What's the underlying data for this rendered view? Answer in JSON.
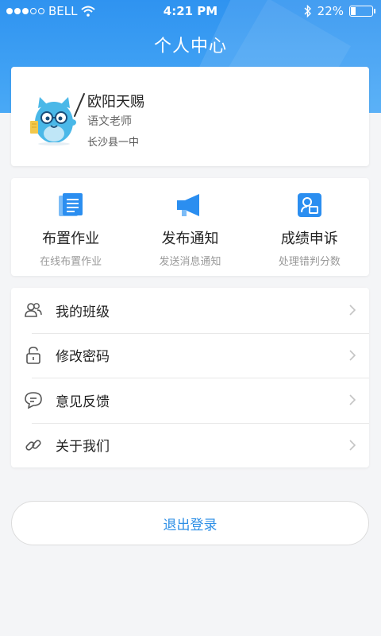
{
  "status_bar": {
    "carrier": "BELL",
    "time": "4:21 PM",
    "battery": "22%",
    "battery_level": 0.22
  },
  "header": {
    "title": "个人中心"
  },
  "profile": {
    "name": "欧阳天赐",
    "role": "语文老师",
    "school": "长沙县一中"
  },
  "actions": [
    {
      "title": "布置作业",
      "subtitle": "在线布置作业",
      "icon": "document-icon"
    },
    {
      "title": "发布通知",
      "subtitle": "发送消息通知",
      "icon": "megaphone-icon"
    },
    {
      "title": "成绩申诉",
      "subtitle": "处理错判分数",
      "icon": "appeal-icon"
    }
  ],
  "menu": [
    {
      "label": "我的班级",
      "icon": "group-icon"
    },
    {
      "label": "修改密码",
      "icon": "lock-icon"
    },
    {
      "label": "意见反馈",
      "icon": "feedback-icon"
    },
    {
      "label": "关于我们",
      "icon": "link-icon"
    }
  ],
  "logout_label": "退出登录",
  "colors": {
    "header_blue": "#2f93f0",
    "accent": "#2e8fe6",
    "icon_blue": "#2b8ef0"
  }
}
